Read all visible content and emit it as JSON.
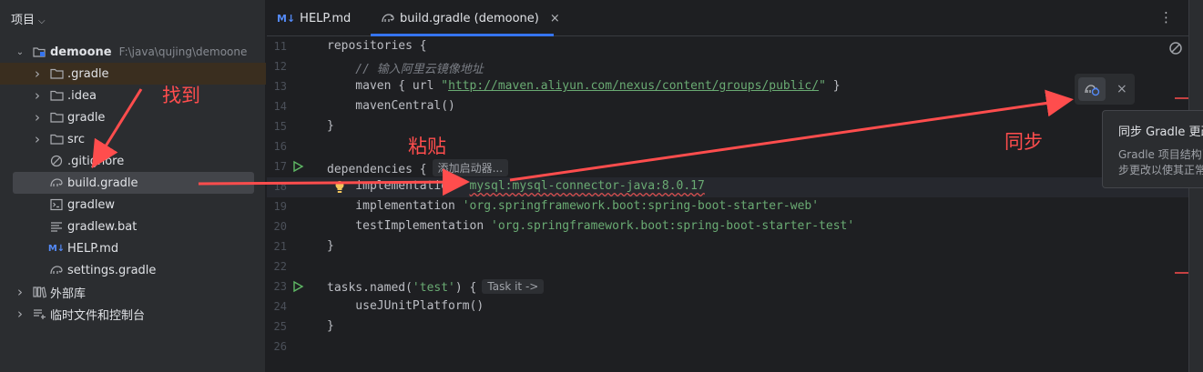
{
  "project_panel": {
    "title": "项目",
    "root": {
      "name": "demoone",
      "path": "F:\\java\\qujing\\demoone"
    },
    "items": [
      {
        "label": ".gradle",
        "type": "folder",
        "indent": 1,
        "expandable": true,
        "selected": true
      },
      {
        "label": ".idea",
        "type": "folder",
        "indent": 1,
        "expandable": true
      },
      {
        "label": "gradle",
        "type": "folder",
        "indent": 1,
        "expandable": true
      },
      {
        "label": "src",
        "type": "folder",
        "indent": 1,
        "expandable": true
      },
      {
        "label": ".gitignore",
        "type": "ignore",
        "indent": 1
      },
      {
        "label": "build.gradle",
        "type": "gradle",
        "indent": 1,
        "highlighted": true
      },
      {
        "label": "gradlew",
        "type": "terminal",
        "indent": 1
      },
      {
        "label": "gradlew.bat",
        "type": "lines",
        "indent": 1
      },
      {
        "label": "HELP.md",
        "type": "markdown",
        "indent": 1
      },
      {
        "label": "settings.gradle",
        "type": "gradle",
        "indent": 1
      },
      {
        "label": "外部库",
        "type": "library",
        "indent": 0,
        "expandable": true
      },
      {
        "label": "临时文件和控制台",
        "type": "scratch",
        "indent": 0,
        "expandable": true
      }
    ]
  },
  "tabs": [
    {
      "label": "HELP.md",
      "badge": "M↓",
      "active": false
    },
    {
      "label": "build.gradle (demoone)",
      "active": true,
      "close": "×"
    }
  ],
  "tab_menu_icon": "more-vertical-icon",
  "editor": {
    "lines": [
      {
        "n": "11",
        "code": "repositories {"
      },
      {
        "n": "12",
        "code": "    // 输入阿里云镜像地址"
      },
      {
        "n": "13",
        "code": "    maven { url \"http://maven.aliyun.com/nexus/content/groups/public/\" }"
      },
      {
        "n": "14",
        "code": "    mavenCentral()"
      },
      {
        "n": "15",
        "code": "}"
      },
      {
        "n": "16",
        "code": ""
      },
      {
        "n": "17",
        "code": "dependencies {",
        "run": true,
        "hint": "添加启动器..."
      },
      {
        "n": "18",
        "code": "    implementation 'mysql:mysql-connector-java:8.0.17",
        "current": true,
        "bulb": true
      },
      {
        "n": "19",
        "code": "    implementation 'org.springframework.boot:spring-boot-starter-web'"
      },
      {
        "n": "20",
        "code": "    testImplementation 'org.springframework.boot:spring-boot-starter-test'"
      },
      {
        "n": "21",
        "code": "}"
      },
      {
        "n": "22",
        "code": ""
      },
      {
        "n": "23",
        "code": "tasks.named('test') {",
        "run": true,
        "hint": "Task it ->"
      },
      {
        "n": "24",
        "code": "    useJUnitPlatform()"
      },
      {
        "n": "25",
        "code": "}"
      },
      {
        "n": "26",
        "code": ""
      }
    ]
  },
  "sync_popup": {
    "icon": "gradle-sync-icon",
    "close": "×",
    "tooltip_title": "同步 Gradle 更改",
    "tooltip_body_1": "Gradle 项目结构已",
    "tooltip_body_2": "步更改以使其正常"
  },
  "annotations": {
    "find": "找到",
    "paste": "粘贴",
    "sync": "同步",
    "color": "#ff4d4d"
  }
}
